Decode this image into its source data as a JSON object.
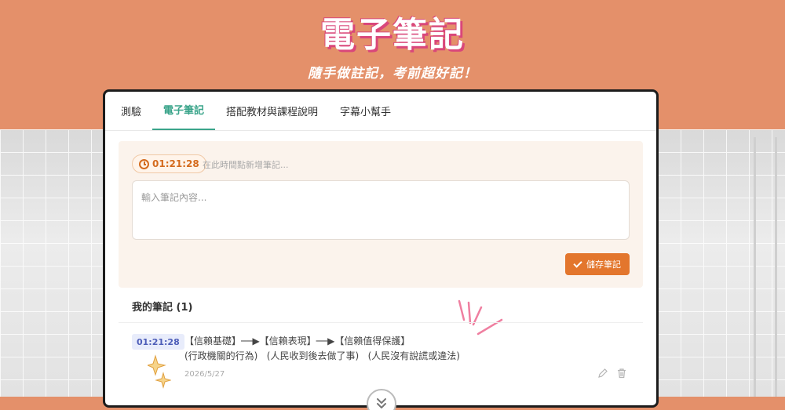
{
  "hero": {
    "title": "電子筆記",
    "subtitle": "隨手做註記，考前超好記！"
  },
  "tabs": [
    {
      "label": "測驗",
      "active": false
    },
    {
      "label": "電子筆記",
      "active": true
    },
    {
      "label": "搭配教材與課程說明",
      "active": false
    },
    {
      "label": "字幕小幫手",
      "active": false
    }
  ],
  "editor": {
    "timestamp": "01:21:28",
    "timestamp_hint": "在此時間點新增筆記...",
    "placeholder": "輸入筆記內容...",
    "save_label": "儲存筆記"
  },
  "notes": {
    "header": "我的筆記 (1)",
    "items": [
      {
        "time": "01:21:28",
        "line1": "【信賴基礎】──▶【信賴表現】──▶【信賴值得保護】",
        "line2": "(行政機關的行為)   (人民收到後去做了事)   (人民沒有說謊或違法)",
        "date": "2026/5/27"
      }
    ]
  },
  "colors": {
    "accent": "#3aa48a",
    "brand_orange": "#e3762d",
    "background": "#e4906a"
  },
  "icons": {
    "clock": "clock-icon",
    "check": "check-icon",
    "edit": "pencil-icon",
    "delete": "trash-icon",
    "scroll": "chevron-double-down-icon"
  }
}
